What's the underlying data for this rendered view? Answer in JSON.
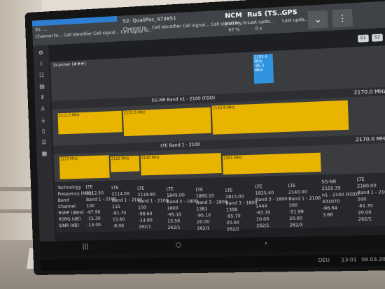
{
  "topbar": {
    "device": "S1:  ...",
    "device_sub": "Channel to...   Cell Identifier   Cell signal...   Cell signal fo...",
    "s2_title": "S2: QualiPoc_473851",
    "s2_sub": "Channel to...   Cell Identifier   Cell signal...   Cell signal fo...",
    "ncm_title": "NCM",
    "ncm_sub": "Battery le...",
    "ncm_val": "97 %",
    "rus_title": "RuS (TS...",
    "rus_sub": "Last upda...",
    "rus_val": "0 s",
    "gps_title": "GPS",
    "gps_sub": "Last upda...",
    "chevron": "⌄",
    "menu": "⋮"
  },
  "pills": [
    "S1",
    "S2"
  ],
  "panels": {
    "scanner_label": "Scanner (###)",
    "nr_label": "5G-NR Band n1 - 2100 (FDD)",
    "nr_freq": "2170.0 MHz",
    "lte_label": "LTE Band 1 - 2100",
    "lte_freq": "2170.0 MHz",
    "blue_block": "2155.4 MHz\n-95.3 dBm",
    "y1": "2112.5 MHz",
    "y2": "2132.5 MHz",
    "y3": "2142.6 MHz",
    "y4": "2113 MHz",
    "y5": "2125 MHz",
    "y6": "2140 MHz",
    "y7": "2161 MHz"
  },
  "table": [
    [
      "Technology",
      "Frequency (MHz)",
      "Band",
      "Channel",
      "RSRP (dBm)",
      "RSRQ (dB)",
      "SINR (dB)"
    ],
    [
      "LTE",
      "2112.50",
      "Band 1 - 2100",
      "100",
      "-97.90",
      "-15.30",
      "-14.00"
    ],
    [
      "LTE",
      "2114.00",
      "Band 1 - 2100",
      "115",
      "-91.70",
      "15.60",
      "-8.00"
    ],
    [
      "LTE",
      "2118.80",
      "Band 1 - 2100",
      "150",
      "-98.60",
      "-14.80",
      "262/1"
    ],
    [
      "LTE",
      "1845.00",
      "Band 3 - 1800",
      "1600",
      "-95.10",
      "15.50",
      "262/1"
    ],
    [
      "LTE",
      "1860.10",
      "Band 3 - 1800",
      "1381",
      "-95.10",
      "20.00",
      "262/1"
    ],
    [
      "LTE",
      "1815.00",
      "Band 3 - 1800",
      "1308",
      "-95.70",
      "20.00",
      "262/1"
    ],
    [
      "LTE",
      "1825.40",
      "Band 3 - 1800",
      "1444",
      "-93.70",
      "10.00",
      "262/1"
    ],
    [
      "LTE",
      "2140.00",
      "Band 1 - 2100",
      "300",
      "-51.99",
      "20.00",
      "262/3"
    ],
    [
      "5G-NR",
      "2155.35",
      "n1 - 2100 (FDD)",
      "431070",
      "-96.64",
      "3.66",
      ""
    ],
    [
      "LTE",
      "2160.00",
      "Band 1 - 2100",
      "500",
      "-61.70",
      "20.00",
      "262/1"
    ]
  ],
  "taskbar": {
    "time": "13:01",
    "date": "08.03.2022",
    "lang": "DEU"
  }
}
